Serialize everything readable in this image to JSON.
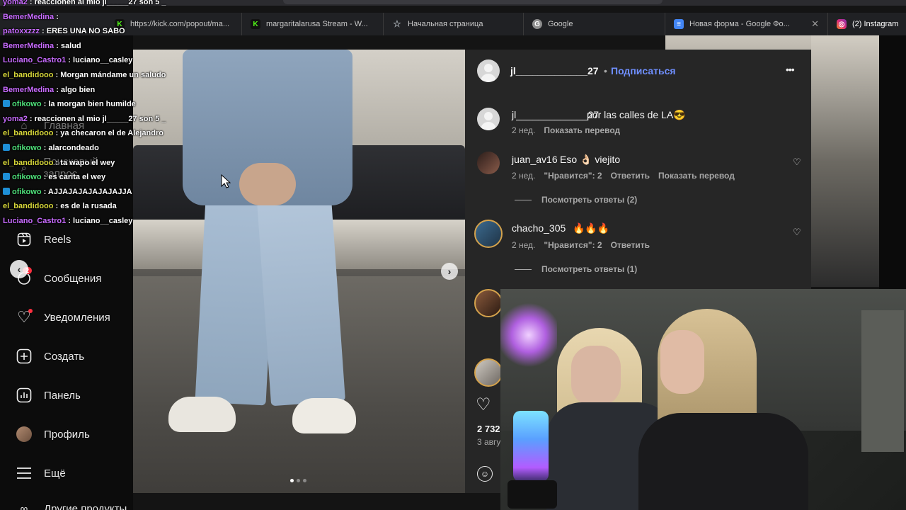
{
  "chat": {
    "messages": [
      {
        "user": "yoma2",
        "text": " : reaccionen al mio jl_____27 son 5 _",
        "color": "#c86bff"
      },
      {
        "user": "BemerMedina",
        "text": " : ",
        "color": "#c86bff"
      },
      {
        "user": "patoxxzzz",
        "text": " : ERES UNA NO SABO",
        "color": "#c86bff"
      },
      {
        "user": "BemerMedina",
        "text": " : salud",
        "color": "#c86bff"
      },
      {
        "user": "Luciano_Castro1",
        "text": " : luciano__casley",
        "color": "#c86bff"
      },
      {
        "user": "el_bandidooo",
        "text": " : Morgan mándame un saludo",
        "color": "#d9d93a"
      },
      {
        "user": "BemerMedina",
        "text": " : algo bien",
        "color": "#c86bff"
      },
      {
        "user": "ofikowo",
        "text": " : la morgan bien humilde",
        "color": "#4ee07a",
        "badge": true
      },
      {
        "user": "yoma2",
        "text": " : reaccionen al mio jl_____27 son 5 _",
        "color": "#c86bff"
      },
      {
        "user": "el_bandidooo",
        "text": " : ya checaron el de Alejandro",
        "color": "#d9d93a"
      },
      {
        "user": "ofikowo",
        "text": " : alarcondeado",
        "color": "#4ee07a",
        "badge": true
      },
      {
        "user": "el_bandidooo",
        "text": " : ta wapo el wey",
        "color": "#d9d93a"
      },
      {
        "user": "ofikowo",
        "text": " : es carita el wey",
        "color": "#4ee07a",
        "badge": true
      },
      {
        "user": "ofikowo",
        "text": " : AJJAJAJAJAJAJAJJA",
        "color": "#4ee07a",
        "badge": true
      },
      {
        "user": "el_bandidooo",
        "text": " : es de la rusada",
        "color": "#d9d93a"
      },
      {
        "user": "Luciano_Castro1",
        "text": " : luciano__casley",
        "color": "#c86bff"
      }
    ]
  },
  "browser": {
    "tabs": [
      {
        "label": "https://kick.com/popout/ma...",
        "icon": "kick-icon",
        "color": "#53fc18"
      },
      {
        "label": "margaritalarusa Stream - W...",
        "icon": "kick-icon",
        "color": "#53fc18"
      },
      {
        "label": "Начальная страница",
        "icon": "star-icon",
        "color": "#9aa0a6"
      },
      {
        "label": "Google",
        "icon": "google-icon",
        "color": "#8e8e8e"
      },
      {
        "label": "Новая форма - Google Фо...",
        "icon": "forms-icon",
        "color": "#4285f4"
      },
      {
        "label": "(2) Instagram",
        "icon": "instagram-icon",
        "color": "#e1306c"
      }
    ]
  },
  "sidebar": {
    "ghost_items": [
      "Главная",
      "Поисковый запрос"
    ],
    "items": [
      {
        "label": "Reels",
        "icon": "reels-icon"
      },
      {
        "label": "Сообщения",
        "icon": "messages-icon",
        "badge": "2"
      },
      {
        "label": "Уведомления",
        "icon": "heart-icon"
      },
      {
        "label": "Создать",
        "icon": "plus-icon"
      },
      {
        "label": "Панель",
        "icon": "dashboard-icon"
      },
      {
        "label": "Профиль",
        "icon": "avatar-icon"
      },
      {
        "label": "Ещё",
        "icon": "menu-icon"
      },
      {
        "label": "Другие продукты",
        "icon": "meta-icon"
      }
    ]
  },
  "post": {
    "author": "jl_____________27",
    "follow_label": "Подписаться",
    "more_label": "•••",
    "caption": {
      "user": "jl_____________27",
      "text": "por las calles de LA😎",
      "time": "2 нед.",
      "translate": "Показать перевод"
    },
    "comments": [
      {
        "user": "juan_av16",
        "text": "Eso 👌🏻 viejito",
        "time": "2 нед.",
        "likes": "\"Нравится\": 2",
        "reply": "Ответить",
        "translate": "Показать перевод",
        "replies": "Посмотреть ответы (2)"
      },
      {
        "user": "chacho_305",
        "text": "🔥🔥🔥",
        "time": "2 нед.",
        "likes": "\"Нравится\": 2",
        "reply": "Ответить",
        "replies": "Посмотреть ответы (1)"
      }
    ],
    "likes_count": "2 732",
    "date": "3 авгу"
  }
}
